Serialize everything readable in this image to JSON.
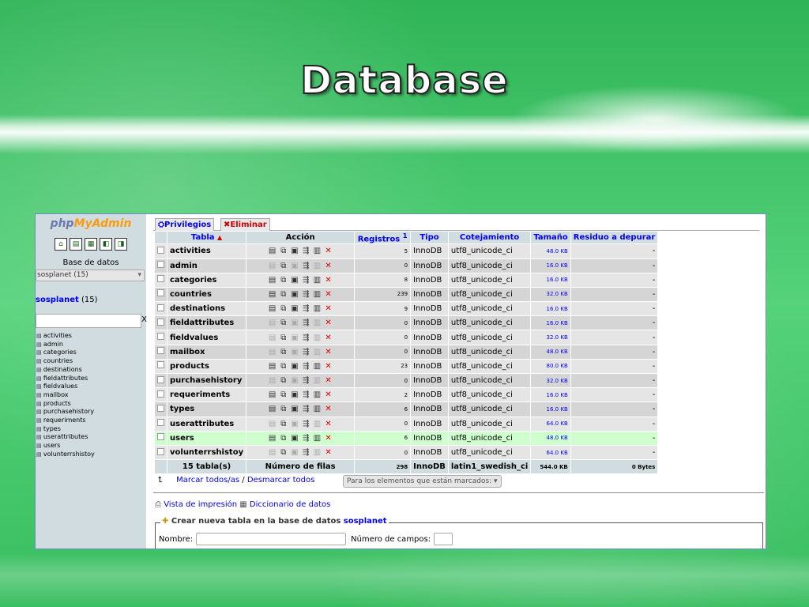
{
  "slide": {
    "title": "Database"
  },
  "sidebar": {
    "logo_php": "php",
    "logo_my": "MyAdmin",
    "icons": [
      "home-icon",
      "sql-icon",
      "export-icon",
      "query-icon",
      "docs-icon"
    ],
    "db_label": "Base de datos",
    "db_select": "sosplanet (15)",
    "db_name": "sosplanet",
    "db_count": "(15)",
    "filter_clear": "X",
    "tables": [
      "activities",
      "admin",
      "categories",
      "countries",
      "destinations",
      "fieldattributes",
      "fieldvalues",
      "mailbox",
      "products",
      "purchasehistory",
      "requeriments",
      "types",
      "userattributes",
      "users",
      "volunterrshistoy"
    ]
  },
  "tabs": {
    "privileges": "Privilegios",
    "drop": "Eliminar"
  },
  "grid": {
    "headers": {
      "table": "Tabla",
      "sort": "▲",
      "action": "Acción",
      "records": "Registros",
      "records_sup": "1",
      "type": "Tipo",
      "collation": "Cotejamiento",
      "size": "Tamaño",
      "overhead": "Residuo a depurar"
    },
    "rows": [
      {
        "name": "activities",
        "records": "5",
        "type": "InnoDB",
        "collation": "utf8_unicode_ci",
        "size": "48.0 KB",
        "overhead": "-"
      },
      {
        "name": "admin",
        "records": "0",
        "type": "InnoDB",
        "collation": "utf8_unicode_ci",
        "size": "16.0 KB",
        "overhead": "-"
      },
      {
        "name": "categories",
        "records": "8",
        "type": "InnoDB",
        "collation": "utf8_unicode_ci",
        "size": "16.0 KB",
        "overhead": "-"
      },
      {
        "name": "countries",
        "records": "239",
        "type": "InnoDB",
        "collation": "utf8_unicode_ci",
        "size": "32.0 KB",
        "overhead": "-"
      },
      {
        "name": "destinations",
        "records": "9",
        "type": "InnoDB",
        "collation": "utf8_unicode_ci",
        "size": "16.0 KB",
        "overhead": "-"
      },
      {
        "name": "fieldattributes",
        "records": "0",
        "type": "InnoDB",
        "collation": "utf8_unicode_ci",
        "size": "16.0 KB",
        "overhead": "-"
      },
      {
        "name": "fieldvalues",
        "records": "0",
        "type": "InnoDB",
        "collation": "utf8_unicode_ci",
        "size": "32.0 KB",
        "overhead": "-"
      },
      {
        "name": "mailbox",
        "records": "0",
        "type": "InnoDB",
        "collation": "utf8_unicode_ci",
        "size": "48.0 KB",
        "overhead": "-"
      },
      {
        "name": "products",
        "records": "23",
        "type": "InnoDB",
        "collation": "utf8_unicode_ci",
        "size": "80.0 KB",
        "overhead": "-"
      },
      {
        "name": "purchasehistory",
        "records": "0",
        "type": "InnoDB",
        "collation": "utf8_unicode_ci",
        "size": "32.0 KB",
        "overhead": "-"
      },
      {
        "name": "requeriments",
        "records": "2",
        "type": "InnoDB",
        "collation": "utf8_unicode_ci",
        "size": "16.0 KB",
        "overhead": "-"
      },
      {
        "name": "types",
        "records": "6",
        "type": "InnoDB",
        "collation": "utf8_unicode_ci",
        "size": "16.0 KB",
        "overhead": "-"
      },
      {
        "name": "userattributes",
        "records": "0",
        "type": "InnoDB",
        "collation": "utf8_unicode_ci",
        "size": "64.0 KB",
        "overhead": "-"
      },
      {
        "name": "users",
        "records": "6",
        "type": "InnoDB",
        "collation": "utf8_unicode_ci",
        "size": "48.0 KB",
        "overhead": "-",
        "highlight": true
      },
      {
        "name": "volunterrshistoy",
        "records": "0",
        "type": "InnoDB",
        "collation": "utf8_unicode_ci",
        "size": "64.0 KB",
        "overhead": "-"
      }
    ],
    "footer": {
      "tables": "15 tabla(s)",
      "rows_label": "Número de filas",
      "records": "298",
      "type": "InnoDB",
      "collation": "latin1_swedish_ci",
      "size": "544.0 KB",
      "overhead": "0 Bytes"
    }
  },
  "bulk": {
    "mark_all": "Marcar todos/as",
    "sep": "/",
    "unmark_all": "Desmarcar todos",
    "with_selected": "Para los elementos que están marcados:"
  },
  "links": {
    "print_view": "Vista de impresión",
    "data_dictionary": "Diccionario de datos"
  },
  "create": {
    "legend": "Crear nueva tabla en la base de datos",
    "db": "sosplanet",
    "name_label": "Nombre:",
    "fields_label": "Número de campos:"
  },
  "colors": {
    "link": "#0000ee",
    "header_bg": "#d0dce0",
    "drop_red": "#e00000",
    "highlight_row": "#cfffcf"
  }
}
